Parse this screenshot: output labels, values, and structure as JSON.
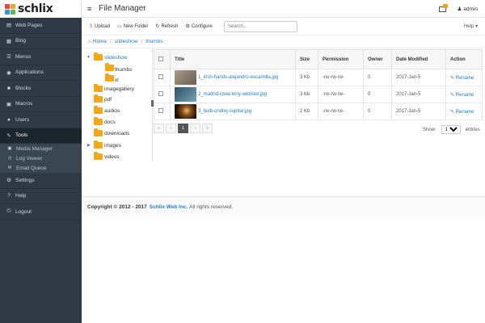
{
  "brand": {
    "name": "schlix"
  },
  "sidebar": {
    "items": [
      {
        "label": "Web Pages",
        "icon": "document-icon"
      },
      {
        "label": "Blog",
        "icon": "blog-icon"
      },
      {
        "label": "Menus",
        "icon": "menu-icon"
      },
      {
        "label": "Applications",
        "icon": "applications-icon"
      },
      {
        "label": "Blocks",
        "icon": "blocks-icon"
      },
      {
        "label": "Macros",
        "icon": "macros-icon"
      },
      {
        "label": "Users",
        "icon": "users-icon"
      },
      {
        "label": "Tools",
        "icon": "tools-icon"
      }
    ],
    "subitems": [
      {
        "label": "Media Manager",
        "icon": "media-icon"
      },
      {
        "label": "Log Viewer",
        "icon": "log-icon"
      },
      {
        "label": "Email Queue",
        "icon": "email-icon"
      }
    ],
    "bottom_items": [
      {
        "label": "Settings",
        "icon": "gear-icon"
      },
      {
        "label": "Help",
        "icon": "help-icon"
      },
      {
        "label": "Logout",
        "icon": "logout-icon"
      }
    ]
  },
  "header": {
    "title": "File Manager",
    "user": "admin"
  },
  "toolbar": {
    "upload": "Upload",
    "new_folder": "New Folder",
    "refresh": "Refresh",
    "configure": "Configure",
    "search_placeholder": "Search...",
    "help": "Help"
  },
  "breadcrumb": {
    "home": "Home",
    "parts": [
      "slideshow",
      "thumbs"
    ]
  },
  "tree": [
    {
      "label": "slideshow",
      "link": true
    },
    {
      "label": "thumbs",
      "link": false
    },
    {
      "label": "xl",
      "link": false
    },
    {
      "label": "imagegallery",
      "link": false
    },
    {
      "label": "pdf",
      "link": false
    },
    {
      "label": "audios",
      "link": false
    },
    {
      "label": "docs",
      "link": false
    },
    {
      "label": "downloads",
      "link": false
    },
    {
      "label": "images",
      "link": false
    },
    {
      "label": "videos",
      "link": false
    }
  ],
  "table": {
    "headers": [
      "Title",
      "Size",
      "Permission",
      "Owner",
      "Date Modified",
      "Action"
    ],
    "rows": [
      {
        "name": "1_irish-hands-alejandro-escamilla.jpg",
        "size": "3 Kb",
        "permission": "-rw-rw-rw-",
        "owner": "0",
        "date": "2017-Jan-5",
        "action": "Rename",
        "thumb": "#8a7f70"
      },
      {
        "name": "2_madrid-iowa-tony-webster.jpg",
        "size": "3 Kb",
        "permission": "-rw-rw-rw-",
        "owner": "0",
        "date": "2017-Jan-5",
        "action": "Rename",
        "thumb": "#3f6b80"
      },
      {
        "name": "3_bulb-ondrej-supitar.jpg",
        "size": "2 Kb",
        "permission": "-rw-rw-rw-",
        "owner": "0",
        "date": "2017-Jan-5",
        "action": "Rename",
        "thumb": "#5a3a1a"
      }
    ]
  },
  "pagination": {
    "first": "«",
    "prev": "‹",
    "current": "1",
    "next": "›",
    "last": "»",
    "show_label": "Show:",
    "per_page": "15",
    "entries_label": "entries"
  },
  "footer": {
    "copyright": "Copyright © 2012 - 2017",
    "company": "Schlix Web Inc.",
    "rights": "All rights reserved."
  },
  "colors": {
    "sidebar": "#2f3a45",
    "accent": "#2a7bbf",
    "folder": "#f2a81c"
  }
}
